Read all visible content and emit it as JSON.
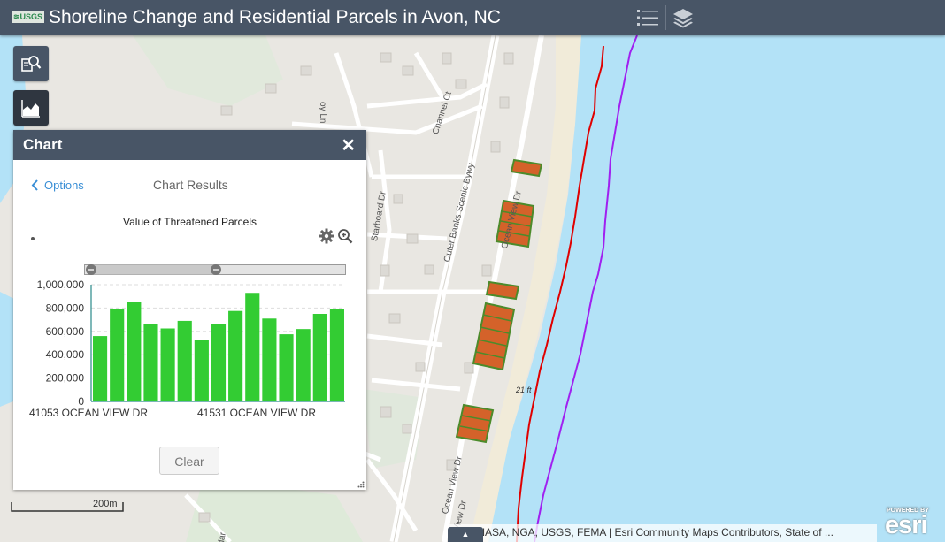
{
  "header": {
    "logo_text": "≋USGS",
    "title": "Shoreline Change and Residential Parcels in Avon, NC",
    "legend_icon": "list-icon",
    "layers_icon": "layers-icon"
  },
  "toolbar": {
    "query_icon": "query-icon",
    "chart_icon": "chart-icon"
  },
  "chart_panel": {
    "title": "Chart",
    "options_label": "Options",
    "results_label": "Chart Results",
    "clear_label": "Clear"
  },
  "chart_data": {
    "type": "bar",
    "title": "Value of Threatened Parcels",
    "values": [
      560000,
      795000,
      850000,
      665000,
      625000,
      690000,
      530000,
      660000,
      775000,
      930000,
      710000,
      575000,
      620000,
      750000,
      795000
    ],
    "ylim": [
      0,
      1000000
    ],
    "yticks": [
      "1,000,000",
      "800,000",
      "600,000",
      "400,000",
      "200,000",
      "0"
    ],
    "xticks": [
      "41053 OCEAN VIEW DR",
      "41531 OCEAN VIEW DR"
    ],
    "bar_color": "#33cc33",
    "grid": true,
    "legend": "none"
  },
  "map": {
    "scale_label": "200m",
    "spot_elevation": "21 ft",
    "attribution": "Esri, NASA, NGA, USGS, FEMA | Esri Community Maps Contributors, State of ...",
    "powered_by": "POWERED BY",
    "esri_logo": "esri",
    "road_labels": [
      "Outer Banks Scenic Bywy",
      "Ocean View Dr",
      "Ocean View Dr",
      "Ocean View Dr",
      "Channel Ct",
      "Starboard Dr",
      "Yardar",
      "oy Ln"
    ],
    "colors": {
      "water": "#b3e2f7",
      "land": "#e8e6e1",
      "header": "#485566",
      "red_shoreline": "#e00000",
      "purple_shoreline": "#a020f0",
      "parcel_fill": "#d4622a",
      "parcel_outline": "#4c8b2b"
    }
  }
}
